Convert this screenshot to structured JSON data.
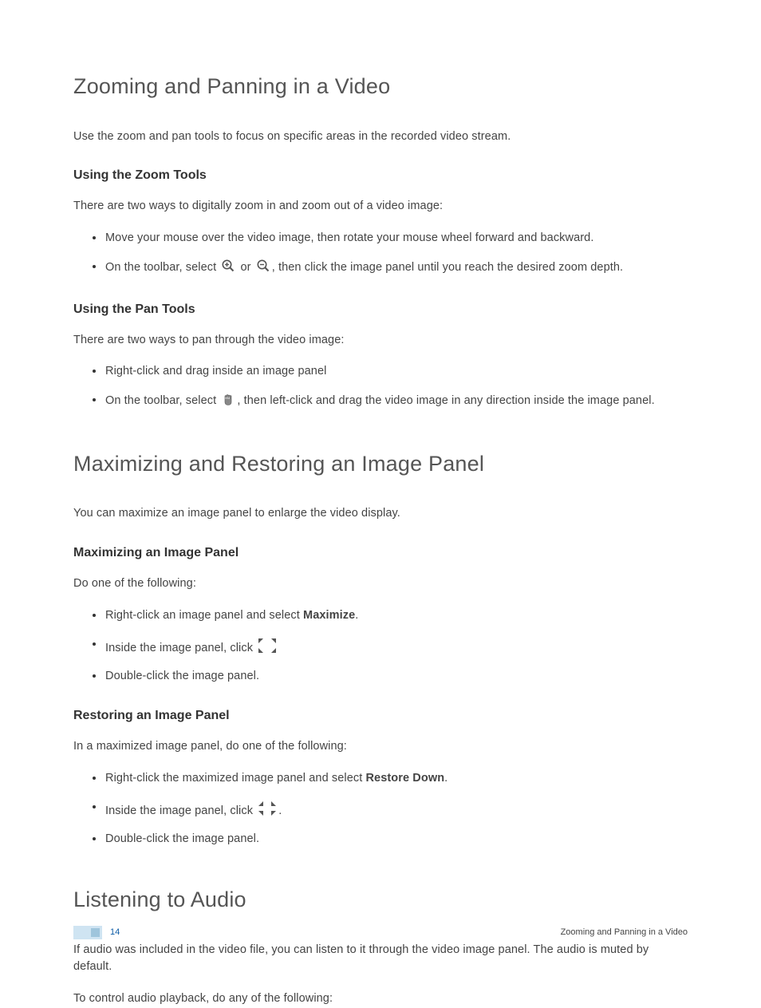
{
  "sections": [
    {
      "heading": "Zooming and Panning in a Video",
      "intro": "Use the zoom and pan tools to focus on specific areas in the recorded video stream.",
      "subsections": [
        {
          "heading": "Using the Zoom Tools",
          "intro": "There are two ways to digitally zoom in and zoom out of a video image:",
          "items": [
            {
              "text": "Move your mouse over the video image, then rotate your mouse wheel forward and backward."
            },
            {
              "prefix": "On the toolbar, select ",
              "icon1": "zoom-in",
              "mid": " or ",
              "icon2": "zoom-out",
              "suffix": ", then click the image panel until you reach the desired zoom depth."
            }
          ]
        },
        {
          "heading": "Using the Pan Tools",
          "intro": "There are two ways to pan through the video image:",
          "items": [
            {
              "text": "Right-click and drag inside an image panel"
            },
            {
              "prefix": "On the toolbar, select ",
              "icon1": "hand",
              "suffix": ", then left-click and drag the video image in any direction inside the image panel."
            }
          ]
        }
      ]
    },
    {
      "heading": "Maximizing and Restoring an Image Panel",
      "intro": "You can maximize an image panel to enlarge the video display.",
      "subsections": [
        {
          "heading": "Maximizing an Image Panel",
          "intro": "Do one of the following:",
          "items": [
            {
              "prefix": "Right-click an image panel and select ",
              "bold": "Maximize",
              "suffix": "."
            },
            {
              "prefix": "Inside the image panel, click ",
              "icon1": "expand"
            },
            {
              "text": "Double-click the image panel."
            }
          ]
        },
        {
          "heading": "Restoring an Image Panel",
          "intro": "In a maximized image panel, do one of the following:",
          "items": [
            {
              "prefix": "Right-click the maximized image panel and select ",
              "bold": "Restore Down",
              "suffix": "."
            },
            {
              "prefix": "Inside the image panel, click ",
              "icon1": "restore",
              "suffix": "."
            },
            {
              "text": "Double-click the image panel."
            }
          ]
        }
      ]
    },
    {
      "heading": "Listening to Audio",
      "intro": "If audio was included in the video file, you can listen to it through the video image panel. The audio is muted by default.",
      "intro2": "To control audio playback, do any of the following:"
    }
  ],
  "footer": {
    "page": "14",
    "title": "Zooming and Panning in a Video"
  }
}
